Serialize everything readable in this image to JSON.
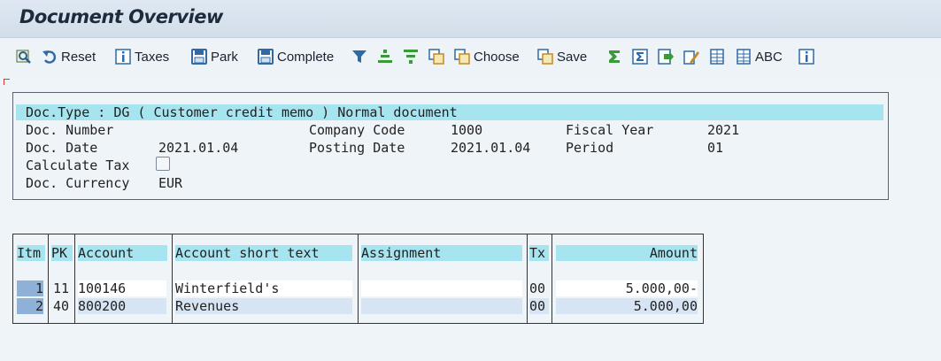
{
  "title": "Document Overview",
  "toolbar": {
    "reset": "Reset",
    "taxes": "Taxes",
    "park": "Park",
    "complete": "Complete",
    "choose": "Choose",
    "save": "Save",
    "abc": "ABC"
  },
  "header": {
    "doc_type_line": "Doc.Type : DG ( Customer credit memo ) Normal document",
    "doc_number_label": "Doc. Number",
    "doc_number_value": "",
    "company_code_label": "Company Code",
    "company_code_value": "1000",
    "fiscal_year_label": "Fiscal Year",
    "fiscal_year_value": "2021",
    "doc_date_label": "Doc. Date",
    "doc_date_value": "2021.01.04",
    "posting_date_label": "Posting Date",
    "posting_date_value": "2021.01.04",
    "period_label": "Period",
    "period_value": "01",
    "calc_tax_label": "Calculate Tax",
    "calc_tax_checked": false,
    "currency_label": "Doc. Currency",
    "currency_value": "EUR"
  },
  "table": {
    "columns": [
      "Itm",
      "PK",
      "Account",
      "Account short text",
      "Assignment",
      "Tx",
      "Amount"
    ],
    "rows": [
      {
        "itm": "1",
        "pk": "11",
        "account": "100146",
        "text": "Winterfield's",
        "assignment": "",
        "tx": "00",
        "amount": "5.000,00-"
      },
      {
        "itm": "2",
        "pk": "40",
        "account": "800200",
        "text": "Revenues",
        "assignment": "",
        "tx": "00",
        "amount": "5.000,00"
      }
    ]
  },
  "colors": {
    "header_highlight": "#a6e4f0",
    "selected_row": "#8fb1d8",
    "background": "#eff4f9"
  }
}
